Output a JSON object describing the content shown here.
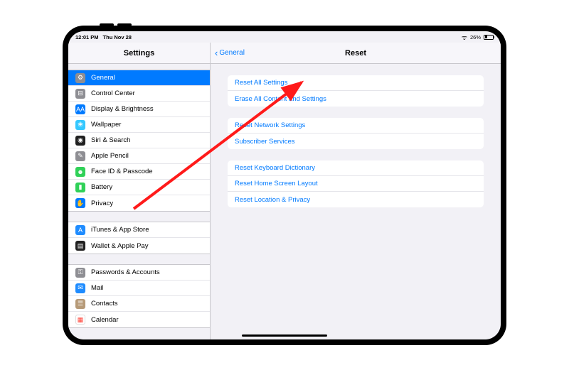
{
  "statusbar": {
    "time": "12:01 PM",
    "date": "Thu Nov 28",
    "battery_pct": "26%"
  },
  "sidebar": {
    "title": "Settings",
    "groups": [
      [
        {
          "label": "General",
          "icon": "gear-icon",
          "bg": "#8e8e93",
          "glyph": "⚙",
          "selected": true
        },
        {
          "label": "Control Center",
          "icon": "sliders-icon",
          "bg": "#8e8e93",
          "glyph": "⊟"
        },
        {
          "label": "Display & Brightness",
          "icon": "display-icon",
          "bg": "#007aff",
          "glyph": "AA"
        },
        {
          "label": "Wallpaper",
          "icon": "wallpaper-icon",
          "bg": "#34c8ff",
          "glyph": "❀"
        },
        {
          "label": "Siri & Search",
          "icon": "siri-icon",
          "bg": "#202020",
          "glyph": "◉"
        },
        {
          "label": "Apple Pencil",
          "icon": "pencil-icon",
          "bg": "#8e8e93",
          "glyph": "✎"
        },
        {
          "label": "Face ID & Passcode",
          "icon": "faceid-icon",
          "bg": "#30d158",
          "glyph": "☻"
        },
        {
          "label": "Battery",
          "icon": "battery-icon",
          "bg": "#30d158",
          "glyph": "▮"
        },
        {
          "label": "Privacy",
          "icon": "privacy-icon",
          "bg": "#007aff",
          "glyph": "✋"
        }
      ],
      [
        {
          "label": "iTunes & App Store",
          "icon": "appstore-icon",
          "bg": "#1f8cff",
          "glyph": "A"
        },
        {
          "label": "Wallet & Apple Pay",
          "icon": "wallet-icon",
          "bg": "#202020",
          "glyph": "▤"
        }
      ],
      [
        {
          "label": "Passwords & Accounts",
          "icon": "key-icon",
          "bg": "#8e8e93",
          "glyph": "⚿"
        },
        {
          "label": "Mail",
          "icon": "mail-icon",
          "bg": "#1f8cff",
          "glyph": "✉"
        },
        {
          "label": "Contacts",
          "icon": "contacts-icon",
          "bg": "#b69a78",
          "glyph": "☰"
        },
        {
          "label": "Calendar",
          "icon": "calendar-icon",
          "bg": "#ffffff",
          "glyph": "▦"
        }
      ]
    ]
  },
  "detail": {
    "back_label": "General",
    "title": "Reset",
    "groups": [
      [
        {
          "label": "Reset All Settings"
        },
        {
          "label": "Erase All Content and Settings"
        }
      ],
      [
        {
          "label": "Reset Network Settings"
        },
        {
          "label": "Subscriber Services"
        }
      ],
      [
        {
          "label": "Reset Keyboard Dictionary"
        },
        {
          "label": "Reset Home Screen Layout"
        },
        {
          "label": "Reset Location & Privacy"
        }
      ]
    ]
  }
}
